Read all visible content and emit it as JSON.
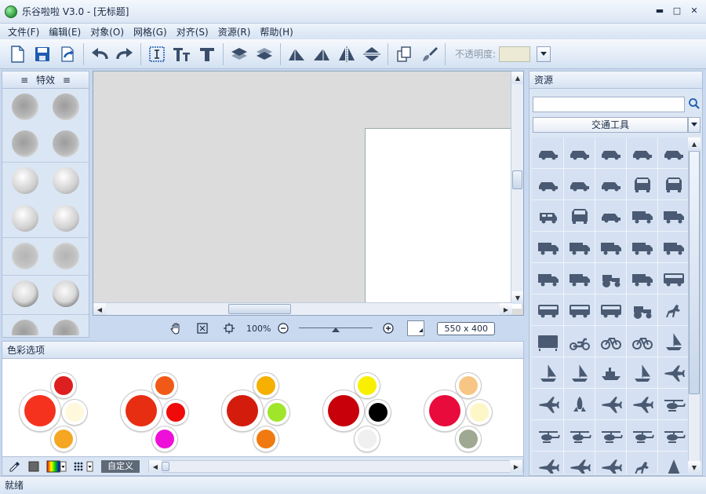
{
  "window": {
    "title": "乐谷啦啦 V3.0 - [无标题]"
  },
  "menu": [
    "文件(F)",
    "编辑(E)",
    "对象(O)",
    "网格(G)",
    "对齐(S)",
    "资源(R)",
    "帮助(H)"
  ],
  "toolbar": {
    "tools": [
      "new-doc",
      "save",
      "export",
      "undo",
      "redo",
      "text-box",
      "text-style",
      "text-effect",
      "layer-up",
      "layer-down",
      "skew-left",
      "skew-right",
      "flip-horizontal",
      "flip-vertical",
      "copy",
      "brush"
    ],
    "opacity_label": "不透明度:",
    "opacity_value": ""
  },
  "effects": {
    "title": "特效"
  },
  "zoom": {
    "percent": "100%",
    "canvas_size": "550 x 400",
    "level": 0.5
  },
  "colors": {
    "title": "色彩选项",
    "custom_label": "自定义",
    "palettes": [
      {
        "main": "#f5321e",
        "top": "#de1f1f",
        "right": "#fff8dc",
        "bottom": "#f5a623"
      },
      {
        "main": "#e82e12",
        "top": "#f05a16",
        "right": "#f00a0a",
        "bottom": "#ee10d8"
      },
      {
        "main": "#d41c0c",
        "top": "#f5b000",
        "right": "#9fe52c",
        "bottom": "#f07a10"
      },
      {
        "main": "#c8000a",
        "top": "#f8f000",
        "right": "#000000",
        "bottom": "#f0f0f0"
      },
      {
        "main": "#e80b3c",
        "top": "#f7c684",
        "right": "#fdf7c8",
        "bottom": "#9fa890"
      }
    ]
  },
  "resources": {
    "title": "资源",
    "search_value": "",
    "category": "交通工具"
  },
  "status": {
    "text": "就绪"
  }
}
